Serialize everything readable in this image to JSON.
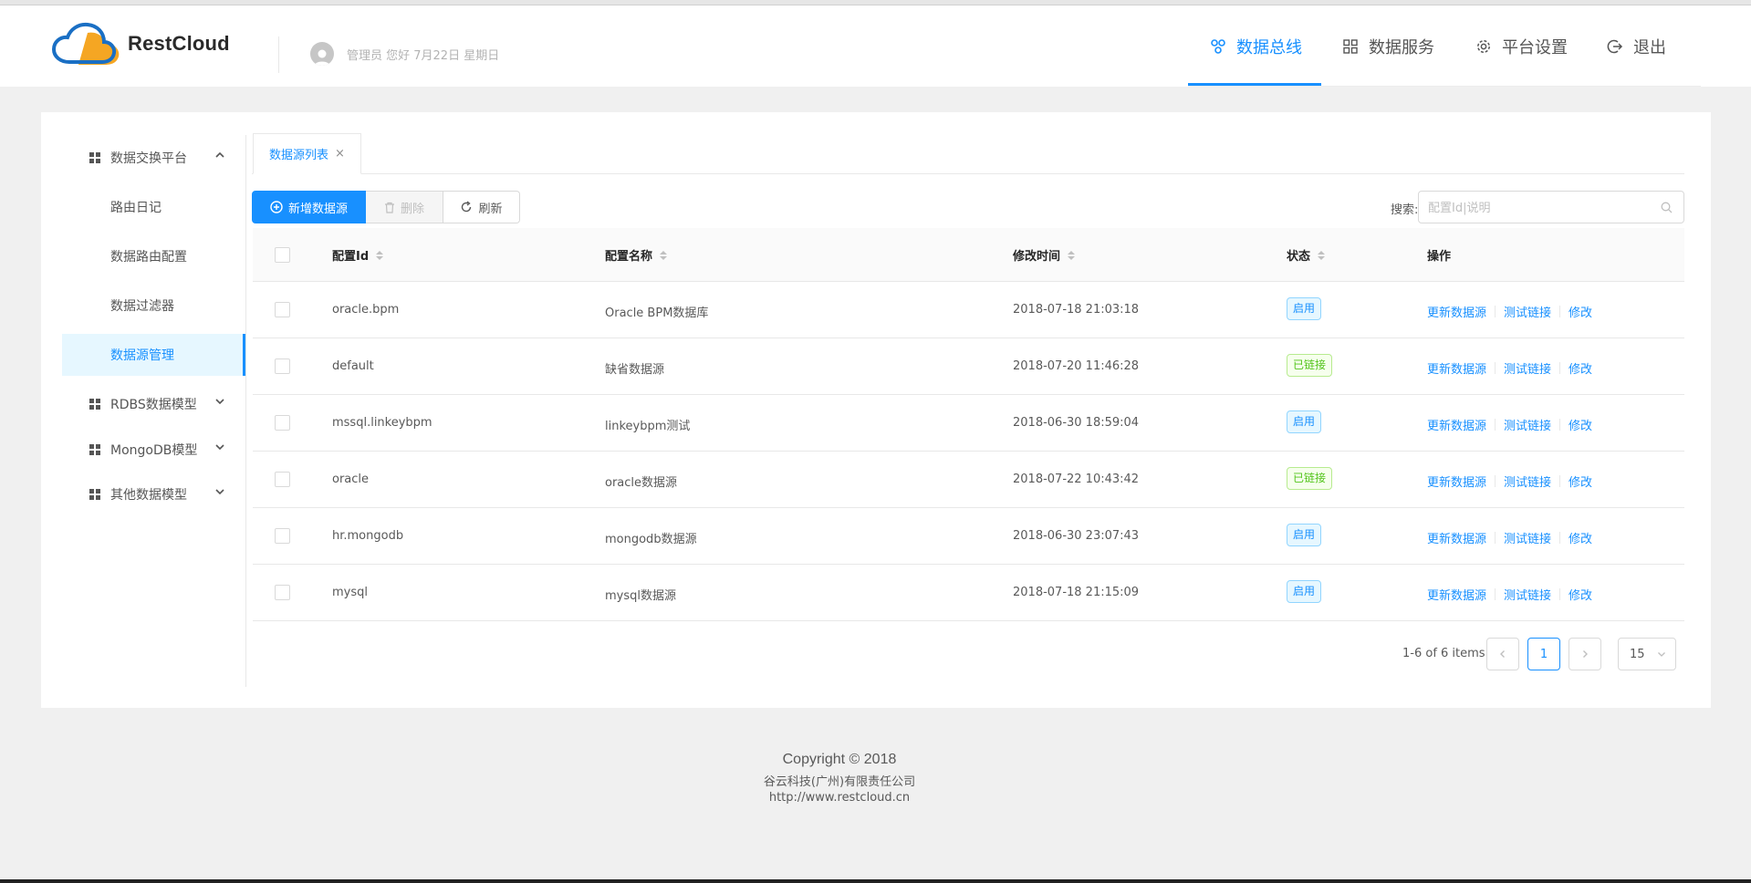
{
  "app": {
    "brand": "RestCloud",
    "greeting": "管理员 您好 7月22日 星期日"
  },
  "topnav": [
    {
      "label": "数据总线",
      "icon": "network-icon",
      "active": true
    },
    {
      "label": "数据服务",
      "icon": "grid-icon",
      "active": false
    },
    {
      "label": "平台设置",
      "icon": "gear-icon",
      "active": false
    },
    {
      "label": "退出",
      "icon": "logout-icon",
      "active": false
    }
  ],
  "sidebar": {
    "group1": "数据交换平台",
    "items": [
      "路由日记",
      "数据路由配置",
      "数据过滤器",
      "数据源管理"
    ],
    "group2": "RDBS数据模型",
    "group3": "MongoDB模型",
    "group4": "其他数据模型"
  },
  "tab": {
    "label": "数据源列表",
    "close": "×"
  },
  "toolbar": {
    "add_label": "新增数据源",
    "delete_label": "删除",
    "refresh_label": "刷新",
    "search_label": "搜索:",
    "search_placeholder": "配置Id|说明"
  },
  "table": {
    "headers": {
      "id": "配置Id",
      "name": "配置名称",
      "time": "修改时间",
      "status": "状态",
      "ops": "操作"
    },
    "rows": [
      {
        "id": "oracle.bpm",
        "name": "Oracle BPM数据库",
        "time": "2018-07-18 21:03:18",
        "status": "启用",
        "status_type": "blue"
      },
      {
        "id": "default",
        "name": "缺省数据源",
        "time": "2018-07-20 11:46:28",
        "status": "已链接",
        "status_type": "green"
      },
      {
        "id": "mssql.linkeybpm",
        "name": "linkeybpm测试",
        "time": "2018-06-30 18:59:04",
        "status": "启用",
        "status_type": "blue"
      },
      {
        "id": "oracle",
        "name": "oracle数据源",
        "time": "2018-07-22 10:43:42",
        "status": "已链接",
        "status_type": "green"
      },
      {
        "id": "hr.mongodb",
        "name": "mongodb数据源",
        "time": "2018-06-30 23:07:43",
        "status": "启用",
        "status_type": "blue"
      },
      {
        "id": "mysql",
        "name": "mysql数据源",
        "time": "2018-07-18 21:15:09",
        "status": "启用",
        "status_type": "blue"
      }
    ],
    "ops": [
      "更新数据源",
      "测试链接",
      "修改"
    ]
  },
  "pagination": {
    "total": "1-6 of 6 items",
    "current": "1",
    "page_size": "15"
  },
  "footer": {
    "copyright": "Copyright © 2018",
    "company": "谷云科技(广州)有限责任公司",
    "url": "http://www.restcloud.cn"
  },
  "colors": {
    "accent": "#1890ff",
    "success": "#52c41a"
  }
}
